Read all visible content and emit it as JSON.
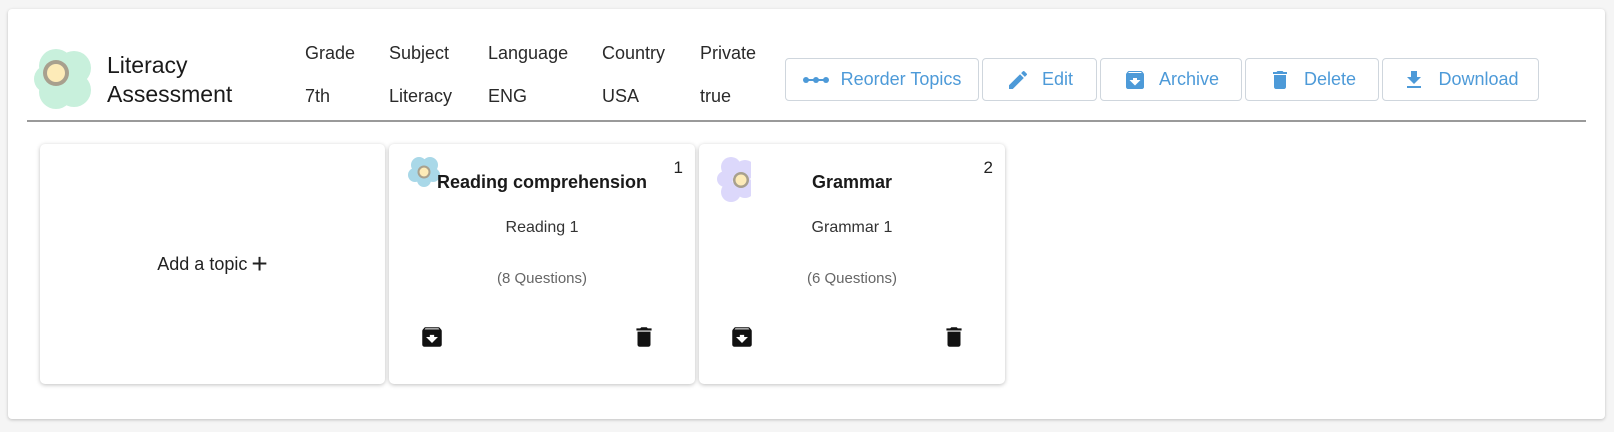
{
  "header": {
    "title_line1": "Literacy",
    "title_line2": "Assessment",
    "meta": [
      {
        "key": "Grade",
        "value": "7th"
      },
      {
        "key": "Subject",
        "value": "Literacy"
      },
      {
        "key": "Language",
        "value": "ENG"
      },
      {
        "key": "Country",
        "value": "USA"
      },
      {
        "key": "Private",
        "value": "true"
      }
    ]
  },
  "toolbar": {
    "reorder_label": "Reorder Topics",
    "edit_label": "Edit",
    "archive_label": "Archive",
    "delete_label": "Delete",
    "download_label": "Download"
  },
  "add_topic": {
    "label": "Add a topic",
    "plus": "+"
  },
  "topics": [
    {
      "name": "Reading comprehension",
      "number": "1",
      "subtitle": "Reading 1",
      "questions": "(8 Questions)",
      "icon": "flower-icon-blue"
    },
    {
      "name": "Grammar",
      "number": "2",
      "subtitle": "Grammar 1",
      "questions": "(6 Questions)",
      "icon": "flower-icon-lavender"
    }
  ],
  "colors": {
    "accent": "#4d9ad8",
    "logo_petal": "#c8f0dc",
    "flower_blue": "#a9d8e8",
    "flower_lavender": "#dcd8fb",
    "flower_center": "#fdebb8"
  }
}
